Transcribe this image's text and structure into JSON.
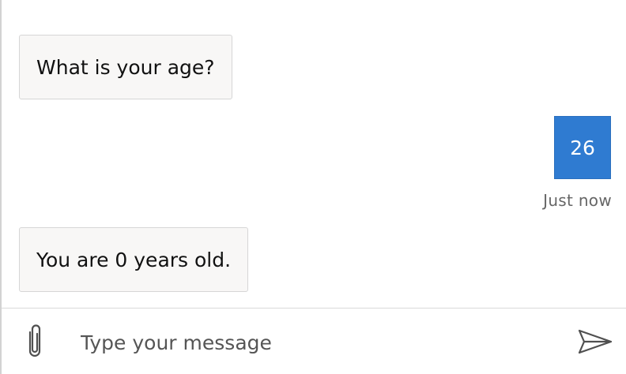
{
  "transcript": {
    "messages": [
      {
        "from": "bot",
        "text": "What is your age?"
      },
      {
        "from": "user",
        "text": "26",
        "timestamp": "Just now"
      },
      {
        "from": "bot",
        "text": "You are 0 years old."
      }
    ]
  },
  "composer": {
    "placeholder": "Type your message",
    "attach_icon": "paperclip-icon",
    "send_icon": "send-icon"
  },
  "colors": {
    "user_bubble": "#2f7bd1",
    "bot_bubble": "#f8f7f6"
  }
}
